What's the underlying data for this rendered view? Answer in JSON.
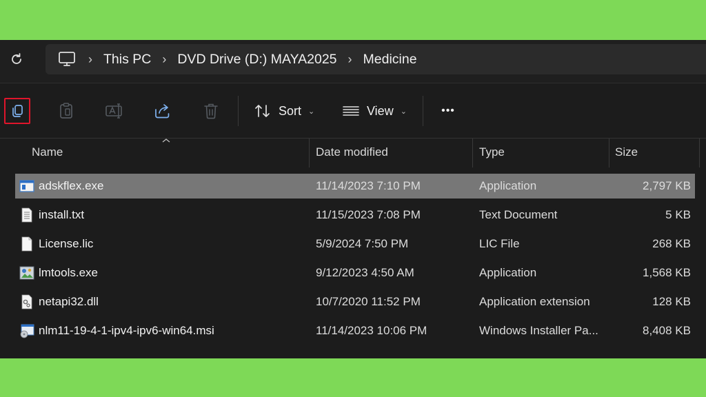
{
  "breadcrumb": {
    "items": [
      "This PC",
      "DVD Drive (D:) MAYA2025",
      "Medicine"
    ]
  },
  "toolbar": {
    "sort_label": "Sort",
    "view_label": "View",
    "more_label": "•••"
  },
  "columns": {
    "name": "Name",
    "date": "Date modified",
    "type": "Type",
    "size": "Size"
  },
  "files": [
    {
      "name": "adskflex.exe",
      "date": "11/14/2023 7:10 PM",
      "type": "Application",
      "size": "2,797 KB",
      "icon": "exe-window-icon",
      "selected": true
    },
    {
      "name": "install.txt",
      "date": "11/15/2023 7:08 PM",
      "type": "Text Document",
      "size": "5 KB",
      "icon": "text-file-icon"
    },
    {
      "name": "License.lic",
      "date": "5/9/2024 7:50 PM",
      "type": "LIC File",
      "size": "268 KB",
      "icon": "blank-file-icon"
    },
    {
      "name": "lmtools.exe",
      "date": "9/12/2023 4:50 AM",
      "type": "Application",
      "size": "1,568 KB",
      "icon": "lmtools-app-icon"
    },
    {
      "name": "netapi32.dll",
      "date": "10/7/2020 11:52 PM",
      "type": "Application extension",
      "size": "128 KB",
      "icon": "dll-gear-icon"
    },
    {
      "name": "nlm11-19-4-1-ipv4-ipv6-win64.msi",
      "date": "11/14/2023 10:06 PM",
      "type": "Windows Installer Pa...",
      "size": "8,408 KB",
      "icon": "msi-installer-icon"
    }
  ],
  "colors": {
    "frame": "#7ed957",
    "background": "#1c1c1c",
    "selected_row": "#777777",
    "highlight_box": "#e0152b"
  }
}
